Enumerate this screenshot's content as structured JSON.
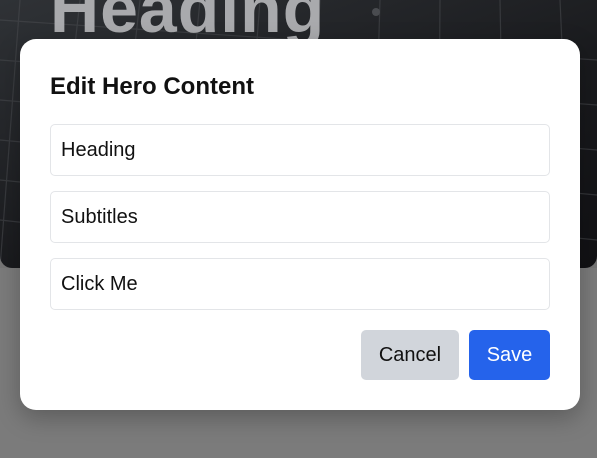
{
  "hero": {
    "heading": "Heading"
  },
  "modal": {
    "title": "Edit Hero Content",
    "fields": [
      {
        "value": "Heading"
      },
      {
        "value": "Subtitles"
      },
      {
        "value": "Click Me"
      }
    ],
    "cancel_label": "Cancel",
    "save_label": "Save"
  },
  "colors": {
    "primary": "#2563eb",
    "secondary": "#d1d5db",
    "overlay": "#757575"
  }
}
